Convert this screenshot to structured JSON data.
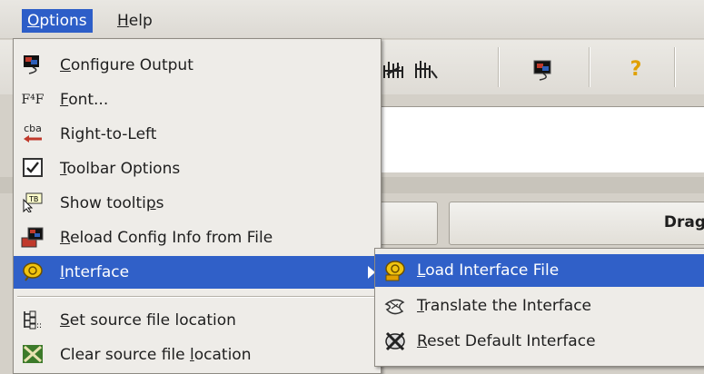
{
  "menubar": {
    "options": {
      "pre": "",
      "ul": "O",
      "post": "ptions"
    },
    "help": {
      "pre": "",
      "ul": "H",
      "post": "elp"
    }
  },
  "toolbar": {
    "icons": [
      "hand-group-icon",
      "hand-group-2-icon",
      "config-monitor-icon",
      "help-icon"
    ],
    "help_glyph": "?"
  },
  "drag_label": "Drag",
  "options_menu": {
    "items": [
      {
        "pre": "",
        "ul": "C",
        "post": "onfigure Output",
        "icon": "monitor-config-icon"
      },
      {
        "pre": "",
        "ul": "F",
        "post": "ont...",
        "icon": "font-icon",
        "icon_text": "F⁴F"
      },
      {
        "pre": "Right-to-Left",
        "ul": "",
        "post": "",
        "icon": "right-to-left-icon",
        "icon_text": "cba"
      },
      {
        "pre": "",
        "ul": "T",
        "post": "oolbar Options",
        "icon": "toolbar-checkbox-icon"
      },
      {
        "pre": "Show toolti",
        "ul": "p",
        "post": "s",
        "icon": "tooltip-icon"
      },
      {
        "pre": "",
        "ul": "R",
        "post": "eload Config Info from File",
        "icon": "reload-config-icon"
      },
      {
        "pre": "",
        "ul": "I",
        "post": "nterface",
        "icon": "interface-icon"
      },
      {
        "pre": "",
        "ul": "S",
        "post": "et source file location",
        "icon": "source-location-icon"
      },
      {
        "pre": "Clear source file ",
        "ul": "l",
        "post": "ocation",
        "icon": "clear-location-icon"
      }
    ]
  },
  "interface_submenu": {
    "items": [
      {
        "pre": "",
        "ul": "L",
        "post": "oad Interface File",
        "icon": "load-interface-icon"
      },
      {
        "pre": "",
        "ul": "T",
        "post": "ranslate the Interface",
        "icon": "translate-interface-icon"
      },
      {
        "pre": "",
        "ul": "R",
        "post": "eset Default Interface",
        "icon": "reset-interface-icon"
      }
    ]
  },
  "colors": {
    "highlight": "#3060c8",
    "menu_bg": "#eeece8",
    "window_bg": "#d4d0c8"
  }
}
